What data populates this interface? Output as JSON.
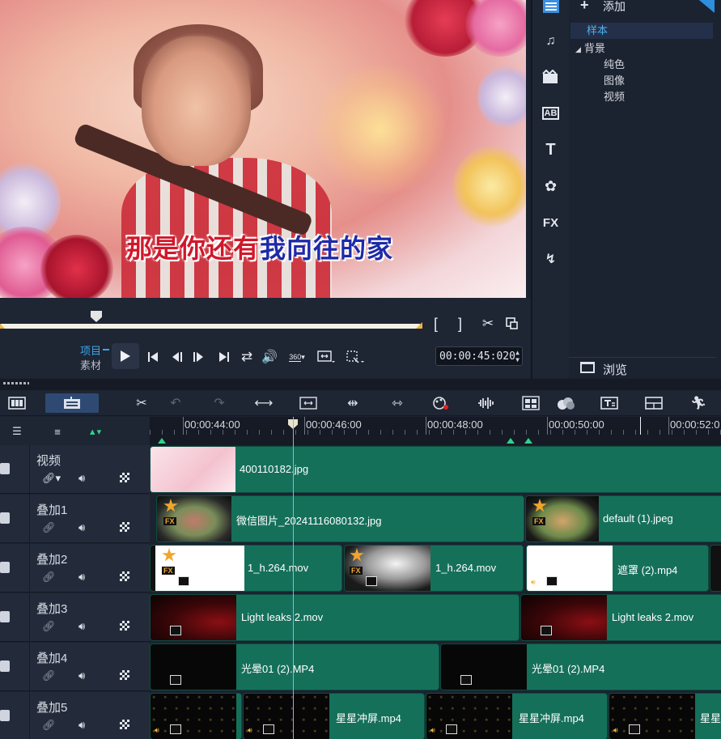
{
  "preview": {
    "lyric_part1": "那是你还有",
    "lyric_part2": "我向往的家"
  },
  "player": {
    "mode_project": "项目",
    "mode_clip": "素材",
    "timecode": "00:00:45:020",
    "mark_in": "[",
    "mark_out": "]",
    "icons": [
      "play-icon",
      "go-start-icon",
      "prev-frame-icon",
      "next-frame-icon",
      "go-end-icon",
      "repeat-icon",
      "volume-icon",
      "360-icon",
      "resize-icon",
      "crop-icon",
      "cut-icon",
      "snapshot-icon"
    ],
    "label_360": "360"
  },
  "side_panel": {
    "icons": [
      "media-icon",
      "music-icon",
      "transition-icon",
      "title-icon",
      "text-icon",
      "graphics-icon",
      "fx-icon",
      "path-icon"
    ],
    "label_fx": "FX",
    "label_ab": "AB",
    "label_t": "T"
  },
  "library": {
    "add_label": "添加",
    "tree": [
      {
        "label": "样本",
        "selected": true
      },
      {
        "label": "背景",
        "expanded": true
      },
      {
        "label": "纯色"
      },
      {
        "label": "图像"
      },
      {
        "label": "视频"
      }
    ],
    "browse_label": "浏览"
  },
  "timeline": {
    "toolbar_icons": [
      "storyboard-view-icon",
      "timeline-view-icon",
      "tools-icon",
      "undo-icon",
      "redo-icon",
      "fit-icon",
      "crop-tool-icon",
      "split-icon",
      "stretch-icon",
      "color-icon",
      "audio-icon",
      "multicam-icon",
      "blend-icon",
      "title-tool-icon",
      "split-screen-icon",
      "motion-icon"
    ],
    "ruler": [
      "00:00:44:00",
      "00:00:46:00",
      "00:00:48:00",
      "00:00:50:00",
      "00:00:52:0"
    ],
    "tracks": [
      {
        "name": "视频",
        "clips": [
          {
            "name": "400110182.jpg"
          }
        ]
      },
      {
        "name": "叠加1",
        "clips": [
          {
            "name": "微信图片_20241116080132.jpg"
          },
          {
            "name": "default (1).jpeg"
          }
        ]
      },
      {
        "name": "叠加2",
        "clips": [
          {
            "name": "1_h.264.mov"
          },
          {
            "name": "1_h.264.mov"
          },
          {
            "name": "遮罩 (2).mp4"
          }
        ]
      },
      {
        "name": "叠加3",
        "clips": [
          {
            "name": "Light leaks 2.mov"
          },
          {
            "name": "Light leaks 2.mov"
          }
        ]
      },
      {
        "name": "叠加4",
        "clips": [
          {
            "name": "光晕01 (2).MP4"
          },
          {
            "name": "光晕01 (2).MP4"
          }
        ]
      },
      {
        "name": "叠加5",
        "clips": [
          {
            "name": "星星冲屏.mp4"
          },
          {
            "name": "星星冲屏.mp4"
          },
          {
            "name": "星星"
          }
        ]
      }
    ],
    "fx_label": "FX"
  }
}
